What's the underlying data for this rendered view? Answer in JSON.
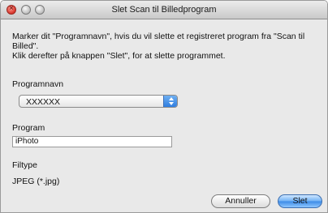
{
  "window": {
    "title": "Slet Scan til Billedprogram"
  },
  "instructions": {
    "line1": "Marker dit \"Programnavn\", hvis du vil slette et registreret program fra \"Scan til Billed\".",
    "line2": "Klik derefter på knappen \"Slet\", for at slette programmet."
  },
  "program_name": {
    "label": "Programnavn",
    "selected_value": "XXXXXX"
  },
  "program": {
    "label": "Program",
    "value": "iPhoto"
  },
  "filetype": {
    "label": "Filtype",
    "value": "JPEG (*.jpg)"
  },
  "buttons": {
    "cancel_label": "Annuller",
    "delete_label": "Slet"
  },
  "colors": {
    "default_button": "#3b8ae6",
    "close_button": "#d8332a"
  }
}
